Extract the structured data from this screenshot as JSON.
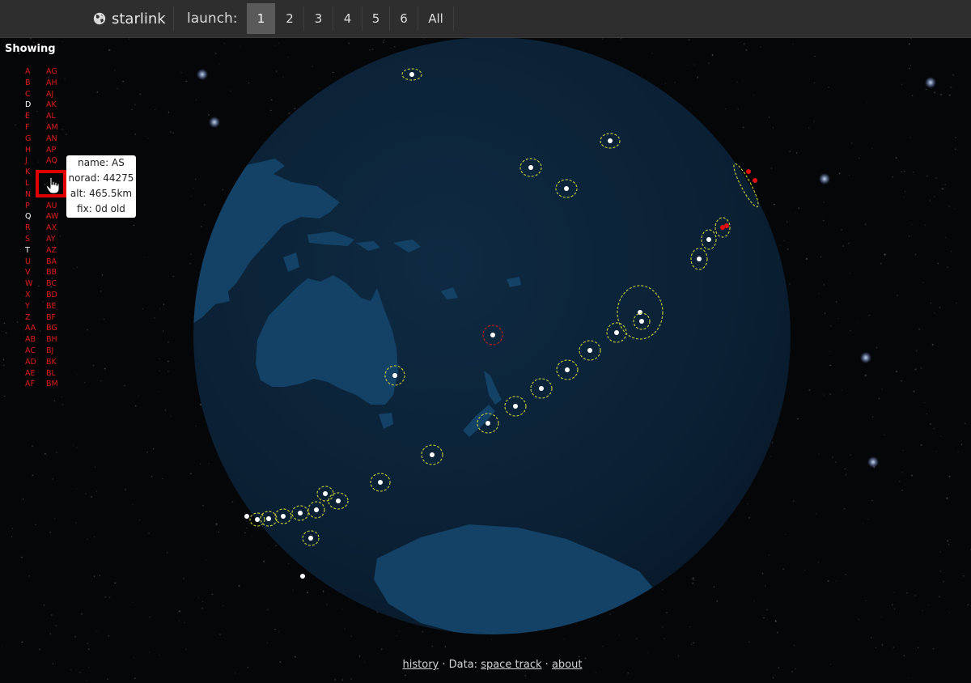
{
  "header": {
    "brand": "starlink",
    "launch_label": "launch:",
    "launch_options": [
      "1",
      "2",
      "3",
      "4",
      "5",
      "6",
      "All"
    ],
    "active_launch": "1"
  },
  "sidebar": {
    "title": "Showing",
    "col1": [
      {
        "label": "A",
        "visible": false
      },
      {
        "label": "B",
        "visible": false
      },
      {
        "label": "C",
        "visible": false
      },
      {
        "label": "D",
        "visible": true
      },
      {
        "label": "E",
        "visible": false
      },
      {
        "label": "F",
        "visible": false
      },
      {
        "label": "G",
        "visible": false
      },
      {
        "label": "H",
        "visible": false
      },
      {
        "label": "J",
        "visible": false
      },
      {
        "label": "K",
        "visible": false
      },
      {
        "label": "L",
        "visible": false
      },
      {
        "label": "N",
        "visible": false
      },
      {
        "label": "P",
        "visible": false
      },
      {
        "label": "Q",
        "visible": true
      },
      {
        "label": "R",
        "visible": false
      },
      {
        "label": "S",
        "visible": false
      },
      {
        "label": "T",
        "visible": true
      },
      {
        "label": "U",
        "visible": false
      },
      {
        "label": "V",
        "visible": false
      },
      {
        "label": "W",
        "visible": false
      },
      {
        "label": "X",
        "visible": false
      },
      {
        "label": "Y",
        "visible": false
      },
      {
        "label": "Z",
        "visible": false
      },
      {
        "label": "AA",
        "visible": false
      },
      {
        "label": "AB",
        "visible": false
      },
      {
        "label": "AC",
        "visible": false
      },
      {
        "label": "AD",
        "visible": false
      },
      {
        "label": "AE",
        "visible": false
      },
      {
        "label": "AF",
        "visible": false
      }
    ],
    "col2": [
      {
        "label": "AG",
        "visible": false
      },
      {
        "label": "AH",
        "visible": false
      },
      {
        "label": "AJ",
        "visible": false
      },
      {
        "label": "AK",
        "visible": false
      },
      {
        "label": "AL",
        "visible": false
      },
      {
        "label": "AM",
        "visible": false
      },
      {
        "label": "AN",
        "visible": false
      },
      {
        "label": "AP",
        "visible": false
      },
      {
        "label": "AQ",
        "visible": false
      },
      {
        "label": "",
        "visible": false
      },
      {
        "label": "",
        "visible": false
      },
      {
        "label": "",
        "visible": false
      },
      {
        "label": "AU",
        "visible": false
      },
      {
        "label": "AW",
        "visible": false
      },
      {
        "label": "AX",
        "visible": false
      },
      {
        "label": "AY",
        "visible": false
      },
      {
        "label": "AZ",
        "visible": false
      },
      {
        "label": "BA",
        "visible": false
      },
      {
        "label": "BB",
        "visible": false
      },
      {
        "label": "BC",
        "visible": false
      },
      {
        "label": "BD",
        "visible": false
      },
      {
        "label": "BE",
        "visible": false
      },
      {
        "label": "BF",
        "visible": false
      },
      {
        "label": "BG",
        "visible": false
      },
      {
        "label": "BH",
        "visible": false
      },
      {
        "label": "BJ",
        "visible": false
      },
      {
        "label": "BK",
        "visible": false
      },
      {
        "label": "BL",
        "visible": false
      },
      {
        "label": "BM",
        "visible": false
      }
    ]
  },
  "tooltip": {
    "name": "name: AS",
    "norad": "norad: 44275",
    "alt": "alt: 465.5km",
    "fix": "fix: 0d old"
  },
  "footer": {
    "history": "history",
    "data_label": " · Data: ",
    "space_track": "space track",
    "dot": " · ",
    "about": "about"
  },
  "colors": {
    "active_label": "#ffffff",
    "inactive_label": "#e21b1b",
    "highlight": "#e00000",
    "orbit_ring": "#b8c23a",
    "ocean": "#0b2236",
    "land": "#134266",
    "stale_satellite": "#e01010"
  }
}
